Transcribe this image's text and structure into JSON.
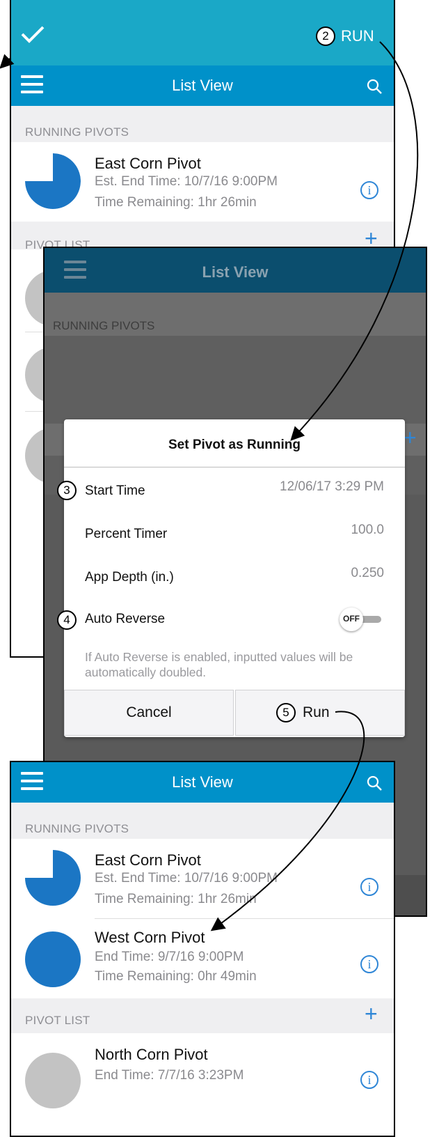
{
  "screen1": {
    "confirm_icon": "checkmark-icon",
    "run_label": "RUN",
    "run_step": "2",
    "nav_title": "List View",
    "running_header": "RUNNING PIVOTS",
    "pivot_list_header": "PIVOT LIST",
    "running_item": {
      "name": "East Corn Pivot",
      "end_time": "Est. End Time: 10/7/16  9:00PM",
      "remaining": "Time Remaining: 1hr 26min",
      "progress_fraction": 0.75
    }
  },
  "screen2": {
    "nav_title": "List View",
    "running_header": "RUNNING PIVOTS",
    "dialog": {
      "title": "Set Pivot as Running",
      "rows": [
        {
          "label": "Start Time",
          "value": "12/06/17 3:29 PM",
          "step": "3"
        },
        {
          "label": "Percent Timer",
          "value": "100.0"
        },
        {
          "label": "App Depth (in.)",
          "value": "0.250"
        },
        {
          "label": "Auto Reverse",
          "toggle": "OFF",
          "step": "4"
        }
      ],
      "note": "If Auto Reverse is enabled, inputted values will be automatically doubled.",
      "cancel_label": "Cancel",
      "run_label": "Run",
      "run_step": "5"
    }
  },
  "screen3": {
    "nav_title": "List View",
    "running_header": "RUNNING PIVOTS",
    "pivot_list_header": "PIVOT LIST",
    "running": [
      {
        "name": "East Corn Pivot",
        "end_time": "Est. End Time: 10/7/16  9:00PM",
        "remaining": "Time Remaining: 1hr 26min",
        "progress_fraction": 0.75
      },
      {
        "name": "West Corn Pivot",
        "end_time": "End Time: 9/7/16  9:00PM",
        "remaining": "Time Remaining: 0hr 49min",
        "progress_fraction": 1.0
      }
    ],
    "list": [
      {
        "name": "North Corn Pivot",
        "end_time": "End Time: 7/7/16  3:23PM"
      }
    ]
  },
  "colors": {
    "teal_bar": "#1aa8c7",
    "nav_blue": "#0091c9",
    "pie_blue": "#1b76c4",
    "inactive_gray": "#c3c3c3",
    "info_blue": "#2f86d6"
  }
}
